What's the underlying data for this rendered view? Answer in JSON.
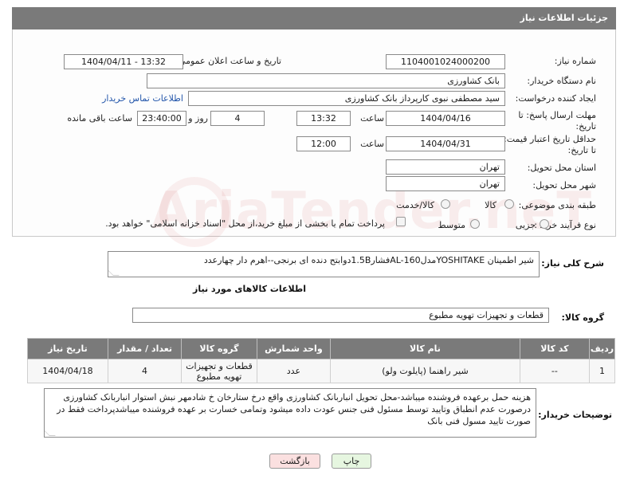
{
  "header": {
    "title": "جزئیات اطلاعات نیاز"
  },
  "fields": {
    "need_number_label": "شماره نیاز:",
    "need_number": "1104001024000200",
    "announce_label": "تاریخ و ساعت اعلان عمومی:",
    "announce_value": "1404/04/11 - 13:32",
    "buyer_org_label": "نام دستگاه خریدار:",
    "buyer_org": "بانک کشاورزی",
    "creator_label": "ایجاد کننده درخواست:",
    "creator": "سید مصطفی نبوی کارپرداز بانک کشاورزی",
    "contact_link": "اطلاعات تماس خریدار",
    "reply_deadline_label_1": "مهلت ارسال پاسخ: تا",
    "reply_deadline_label_2": "تاریخ:",
    "reply_date": "1404/04/16",
    "time_label": "ساعت",
    "reply_time": "13:32",
    "days_value": "4",
    "days_label": "روز و",
    "remaining_time": "23:40:00",
    "remaining_label": "ساعت باقی مانده",
    "validity_label_1": "حداقل تاریخ اعتبار قیمت:",
    "validity_label_2": "تا تاریخ:",
    "validity_date": "1404/04/31",
    "validity_time_label": "ساعت",
    "validity_time": "12:00",
    "province_label": "استان محل تحویل:",
    "province": "تهران",
    "city_label": "شهر محل تحویل:",
    "city": "تهران",
    "category_label": "طبقه بندی موضوعی:",
    "category_options": [
      "کالا",
      "کالا/خدمت"
    ],
    "process_label": "نوع فرآیند خرید :",
    "process_options": [
      "جزیی",
      "متوسط"
    ],
    "payment_note": "پرداخت تمام یا بخشی از مبلغ خرید،از محل \"اسناد خزانه اسلامی\" خواهد بود."
  },
  "watermark": "AriaTender.neT",
  "description": {
    "label": "شرح کلی نیاز:",
    "text": "شیر اطمینان YOSHITAKEمدلAL-160فشار1.5Bدوابتح دنده ای برنجی--اهرم دار  چهارعدد"
  },
  "goods_info_title": "اطلاعات کالاهای مورد نیاز",
  "goods_group": {
    "label": "گروه کالا:",
    "value": "قطعات و تجهیزات تهویه مطبوع"
  },
  "table": {
    "headers": [
      "ردیف",
      "کد کالا",
      "نام کالا",
      "واحد شمارش",
      "گروه کالا",
      "تعداد / مقدار",
      "تاریخ نیاز"
    ],
    "rows": [
      [
        "1",
        "--",
        "شیر راهنما (پایلوت ولو)",
        "عدد",
        "قطعات و تجهیزات تهویه مطبوع",
        "4",
        "1404/04/18"
      ]
    ]
  },
  "buyer_notes": {
    "label": "توضیحات خریدار:",
    "text": "هزینه حمل برعهده فروشنده میباشد-محل تحویل انباربانک کشاورزی واقع درخ ستارخان خ شادمهر نبش استوار انباربانک کشاورزی درصورت عدم انطباق وتایید توسط مسئول فنی جنس عودت داده میشود وتمامی خسارت بر عهده فروشنده میباشدپرداخت فقط در صورت تایید مسول فنی بانک"
  },
  "buttons": {
    "print": "چاپ",
    "back": "بازگشت"
  },
  "colors": {
    "header_bg": "#7a7a7a",
    "link": "#2255aa",
    "back_btn_bg": "#fbe0e0",
    "print_btn_bg": "#e6f6e0"
  }
}
